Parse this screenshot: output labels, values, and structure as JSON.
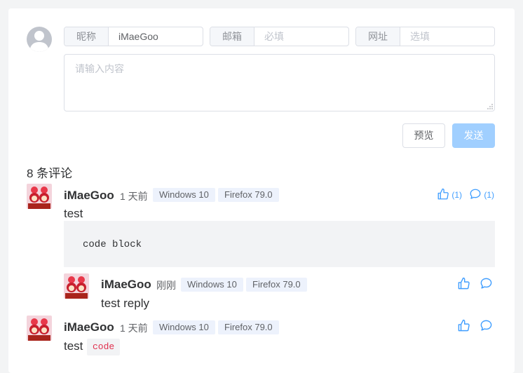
{
  "form": {
    "nick_label": "昵称",
    "nick_value": "iMaeGoo",
    "email_label": "邮箱",
    "email_placeholder": "必填",
    "url_label": "网址",
    "url_placeholder": "选填",
    "content_placeholder": "请输入内容",
    "preview_label": "预览",
    "send_label": "发送"
  },
  "comment_count": "8 条评论",
  "comments": [
    {
      "nick": "iMaeGoo",
      "time": "1 天前",
      "os": "Windows 10",
      "browser": "Firefox 79.0",
      "text": "test",
      "code_block": "code block",
      "like_count": "(1)",
      "reply_count": "(1)",
      "replies": [
        {
          "nick": "iMaeGoo",
          "time": "刚刚",
          "os": "Windows 10",
          "browser": "Firefox 79.0",
          "text": "test reply"
        }
      ]
    },
    {
      "nick": "iMaeGoo",
      "time": "1 天前",
      "os": "Windows 10",
      "browser": "Firefox 79.0",
      "text": "test",
      "inline_code": "code"
    }
  ],
  "icons": {
    "like": "thumbs-up-icon",
    "reply": "speech-bubble-icon",
    "avatar_default": "user-silhouette-icon"
  },
  "colors": {
    "accent": "#409eff",
    "send_disabled": "#a0cfff",
    "tag_bg": "#edf2fc",
    "inline_code": "#e0304e"
  }
}
